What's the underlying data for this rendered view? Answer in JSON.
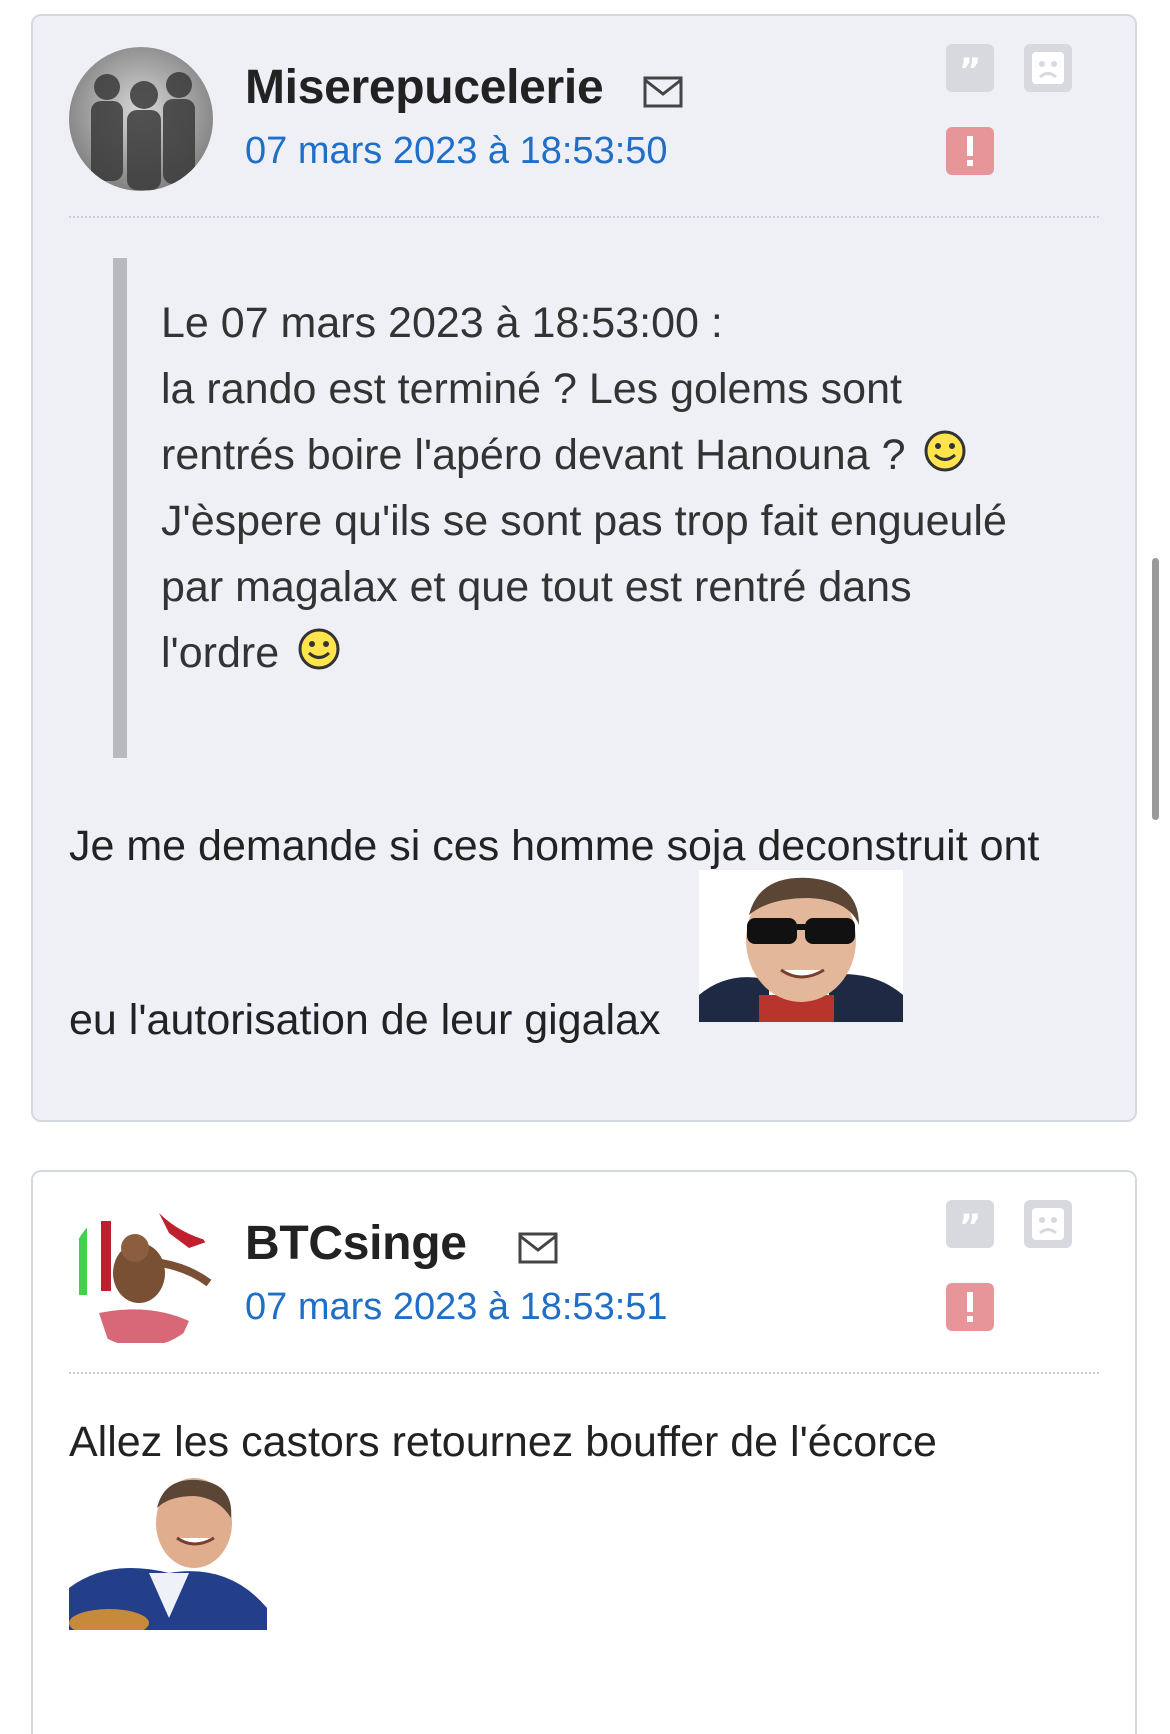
{
  "posts": [
    {
      "author": "Miserepucelerie",
      "date": "07 mars 2023 à 18:53:50",
      "quote": {
        "header": "Le 07 mars 2023 à 18:53:00 :",
        "lines": [
          "la rando est terminé ? Les golems sont",
          "rentrés boire l'apéro devant Hanouna ?",
          "J'èspere qu'ils se sont pas trop fait engueulé",
          "par magalax et que tout est rentré dans",
          "l'ordre"
        ]
      },
      "message": [
        "Je me demande si ces homme soja deconstruit ont",
        "eu l'autorisation de leur gigalax"
      ]
    },
    {
      "author": "BTCsinge",
      "date": "07 mars 2023 à 18:53:51",
      "message": [
        "Allez les castors retournez bouffer de l'écorce"
      ]
    }
  ],
  "icons": {
    "mail": "mail-icon",
    "quote": "quote-icon",
    "sad": "sad-face-icon",
    "alert": "alert-icon",
    "smiley": "smiley-icon"
  },
  "colors": {
    "date": "#1f6ec8",
    "alert_button": "#e8959a",
    "post_background": "#eef0f6"
  }
}
